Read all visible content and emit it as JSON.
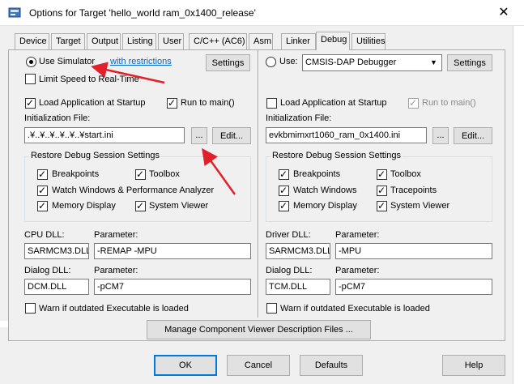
{
  "window": {
    "title": "Options for Target 'hello_world ram_0x1400_release'",
    "close_glyph": "✕"
  },
  "tabs": [
    {
      "label": "Device"
    },
    {
      "label": "Target"
    },
    {
      "label": "Output"
    },
    {
      "label": "Listing"
    },
    {
      "label": "User"
    },
    {
      "label": "C/C++ (AC6)"
    },
    {
      "label": "Asm"
    },
    {
      "label": "Linker"
    },
    {
      "label": "Debug",
      "active": true
    },
    {
      "label": "Utilities"
    }
  ],
  "left": {
    "use_simulator_label": "Use Simulator",
    "with_restrictions_link": "with restrictions",
    "settings_button": "Settings",
    "limit_speed_label": "Limit Speed to Real-Time",
    "load_app_label": "Load Application at Startup",
    "run_to_main_label": "Run to main()",
    "init_file_label": "Initialization File:",
    "init_file_value": ".¥..¥..¥..¥..¥..¥start.ini",
    "browse_button": "...",
    "edit_button": "Edit...",
    "restore_group_title": "Restore Debug Session Settings",
    "restore": {
      "breakpoints": "Breakpoints",
      "toolbox": "Toolbox",
      "watch_windows": "Watch Windows & Performance Analyzer",
      "memory_display": "Memory Display",
      "system_viewer": "System Viewer"
    },
    "cpu_dll_label": "CPU DLL:",
    "cpu_dll_value": "SARMCM3.DLL",
    "cpu_param_label": "Parameter:",
    "cpu_param_value": "-REMAP -MPU",
    "dialog_dll_label": "Dialog DLL:",
    "dialog_dll_value": "DCM.DLL",
    "dialog_param_label": "Parameter:",
    "dialog_param_value": "-pCM7",
    "warn_label": "Warn if outdated Executable is loaded"
  },
  "right": {
    "use_label": "Use:",
    "debugger_value": "CMSIS-DAP Debugger",
    "settings_button": "Settings",
    "load_app_label": "Load Application at Startup",
    "run_to_main_label": "Run to main()",
    "init_file_label": "Initialization File:",
    "init_file_value": "evkbmimxrt1060_ram_0x1400.ini",
    "browse_button": "...",
    "edit_button": "Edit...",
    "restore_group_title": "Restore Debug Session Settings",
    "restore": {
      "breakpoints": "Breakpoints",
      "toolbox": "Toolbox",
      "watch_windows": "Watch Windows",
      "tracepoints": "Tracepoints",
      "memory_display": "Memory Display",
      "system_viewer": "System Viewer"
    },
    "driver_dll_label": "Driver DLL:",
    "driver_dll_value": "SARMCM3.DLL",
    "driver_param_label": "Parameter:",
    "driver_param_value": "-MPU",
    "dialog_dll_label": "Dialog DLL:",
    "dialog_dll_value": "TCM.DLL",
    "dialog_param_label": "Parameter:",
    "dialog_param_value": "-pCM7",
    "warn_label": "Warn if outdated Executable is loaded"
  },
  "manage_button": "Manage Component Viewer Description Files ...",
  "footer": {
    "ok": "OK",
    "cancel": "Cancel",
    "defaults": "Defaults",
    "help": "Help"
  },
  "colors": {
    "annotation_arrow": "#e0202a",
    "link": "#0066cc",
    "focus_border": "#0078d7"
  }
}
